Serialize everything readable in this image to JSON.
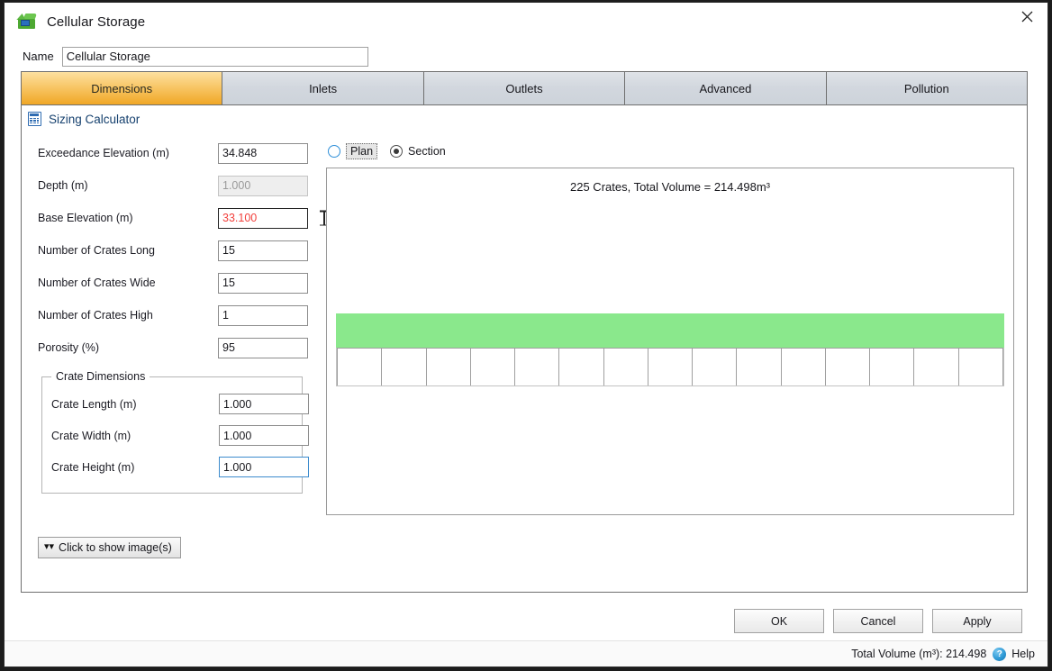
{
  "window": {
    "title": "Cellular Storage",
    "icon": "crate-icon",
    "close_label": "close-icon"
  },
  "name_field": {
    "label": "Name",
    "value": "Cellular Storage",
    "placeholder": ""
  },
  "tabs": [
    {
      "label": "Dimensions",
      "active": true
    },
    {
      "label": "Inlets",
      "active": false
    },
    {
      "label": "Outlets",
      "active": false
    },
    {
      "label": "Advanced",
      "active": false
    },
    {
      "label": "Pollution",
      "active": false
    }
  ],
  "section": {
    "title": "Sizing Calculator",
    "icon": "calculator-icon"
  },
  "form": {
    "fields": [
      {
        "label": "Exceedance Elevation (m)",
        "value": "34.848",
        "state": "normal"
      },
      {
        "label": "Depth (m)",
        "value": "1.000",
        "state": "disabled"
      },
      {
        "label": "Base Elevation (m)",
        "value": "33.100",
        "state": "error"
      },
      {
        "label": "Number of Crates Long",
        "value": "15",
        "state": "normal"
      },
      {
        "label": "Number of Crates Wide",
        "value": "15",
        "state": "normal"
      },
      {
        "label": "Number of Crates High",
        "value": "1",
        "state": "normal"
      },
      {
        "label": "Porosity (%)",
        "value": "95",
        "state": "normal"
      }
    ]
  },
  "crate_group": {
    "legend": "Crate Dimensions",
    "fields": [
      {
        "label": "Crate Length (m)",
        "value": "1.000",
        "state": "normal"
      },
      {
        "label": "Crate Width (m)",
        "value": "1.000",
        "state": "normal"
      },
      {
        "label": "Crate Height (m)",
        "value": "1.000",
        "state": "focused"
      }
    ]
  },
  "view_mode": {
    "options": [
      {
        "label": "Plan",
        "selected": false
      },
      {
        "label": "Section",
        "selected": true
      }
    ]
  },
  "diagram": {
    "title": "225 Crates, Total Volume = 214.498m³",
    "crate_count_long": 15,
    "water_color": "#8ae88c",
    "crate_color": "#ffffff"
  },
  "show_images": {
    "label": "Click to show image(s)",
    "chevron": "»"
  },
  "buttons": {
    "ok": "OK",
    "cancel": "Cancel",
    "apply": "Apply"
  },
  "statusbar": {
    "total_volume_text": "Total Volume (m³): 214.498",
    "help_label": "Help",
    "help_icon": "?"
  }
}
